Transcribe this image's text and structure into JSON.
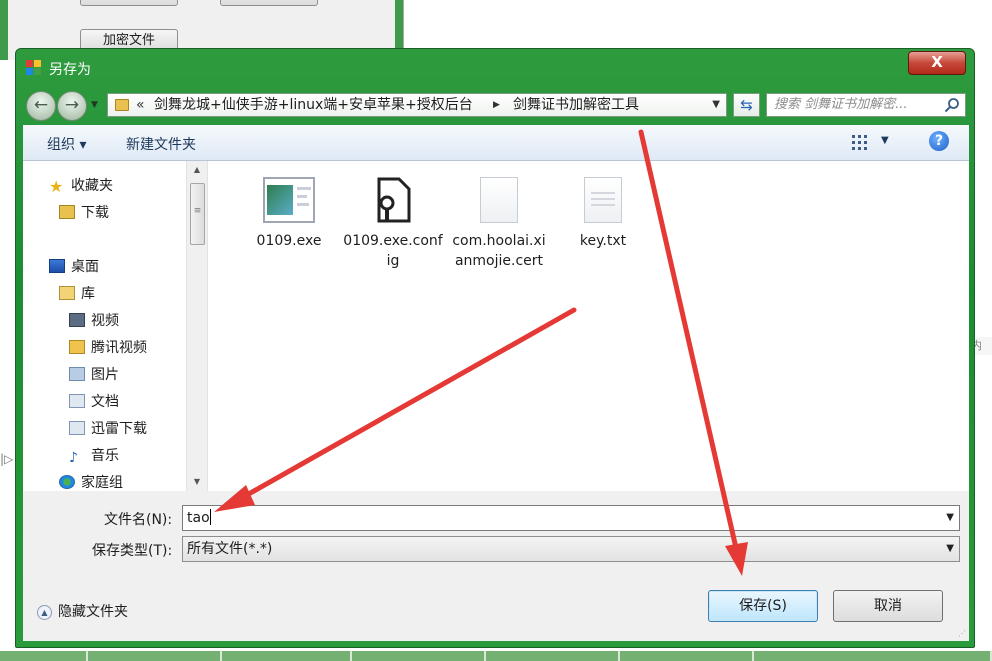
{
  "background_app": {
    "encrypt_button": "加密文件",
    "right_fragment": "内容",
    "left_fragment": "|▷"
  },
  "dialog": {
    "title": "另存为",
    "close_label": "X",
    "address": {
      "chevron": "«",
      "segment1": "剑舞龙城+仙侠手游+linux端+安卓苹果+授权后台",
      "separator": "▶",
      "segment2": "剑舞证书加解密工具"
    },
    "search_placeholder": "搜索 剑舞证书加解密...",
    "toolbar": {
      "organize": "组织 ▾",
      "new_folder": "新建文件夹"
    },
    "nav_pane": {
      "favorites": "收藏夹",
      "downloads": "下载",
      "desktop": "桌面",
      "libraries": "库",
      "videos": "视频",
      "tencent_video": "腾讯视频",
      "pictures": "图片",
      "documents": "文档",
      "xunlei": "迅雷下载",
      "music": "音乐",
      "homegroup": "家庭组"
    },
    "files": [
      {
        "name": "0109.exe",
        "icon": "exe-icon"
      },
      {
        "name": "0109.exe.config",
        "icon": "config-icon"
      },
      {
        "name": "com.hoolai.xianmojie.cert",
        "icon": "document-icon"
      },
      {
        "name": "key.txt",
        "icon": "text-file-icon"
      }
    ],
    "file_name_label": "文件名(N):",
    "file_name_value": "tao",
    "file_type_label": "保存类型(T):",
    "file_type_value": "所有文件(*.*)",
    "hide_folders": "隐藏文件夹",
    "save_button": "保存(S)",
    "cancel_button": "取消"
  },
  "colors": {
    "window_frame": "#2a9b3c",
    "annotation_arrow": "#e53935",
    "toolbar_text": "#1e395b"
  }
}
